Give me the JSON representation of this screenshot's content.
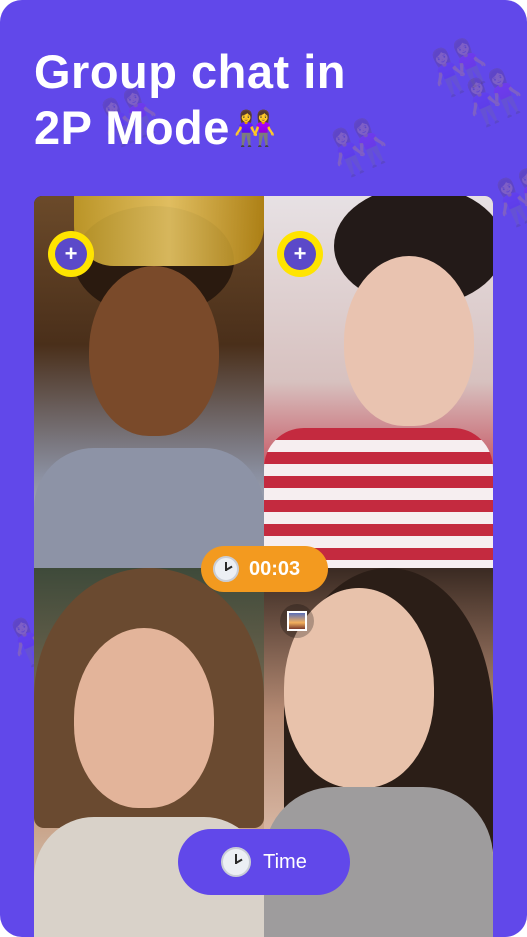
{
  "headline": {
    "line1": "Group chat in",
    "line2": "2P Mode",
    "emoji": "👭"
  },
  "decorations": {
    "icon": "two-women-holding-hands-icon"
  },
  "video_grid": {
    "participants": [
      {
        "id": "participant-1",
        "has_add_button": true
      },
      {
        "id": "participant-2",
        "has_add_button": true
      },
      {
        "id": "participant-3",
        "has_add_button": false
      },
      {
        "id": "participant-4",
        "has_add_button": false
      }
    ],
    "add_button_label": "+"
  },
  "timer": {
    "value": "00:03",
    "icon": "clock-icon",
    "color": "#f39a1f"
  },
  "photo_button": {
    "icon": "photo-icon"
  },
  "time_button": {
    "label": "Time",
    "icon": "clock-icon"
  },
  "colors": {
    "background": "#6148ea",
    "add_ring": "#ffe400",
    "add_inner": "#5b49c9"
  }
}
